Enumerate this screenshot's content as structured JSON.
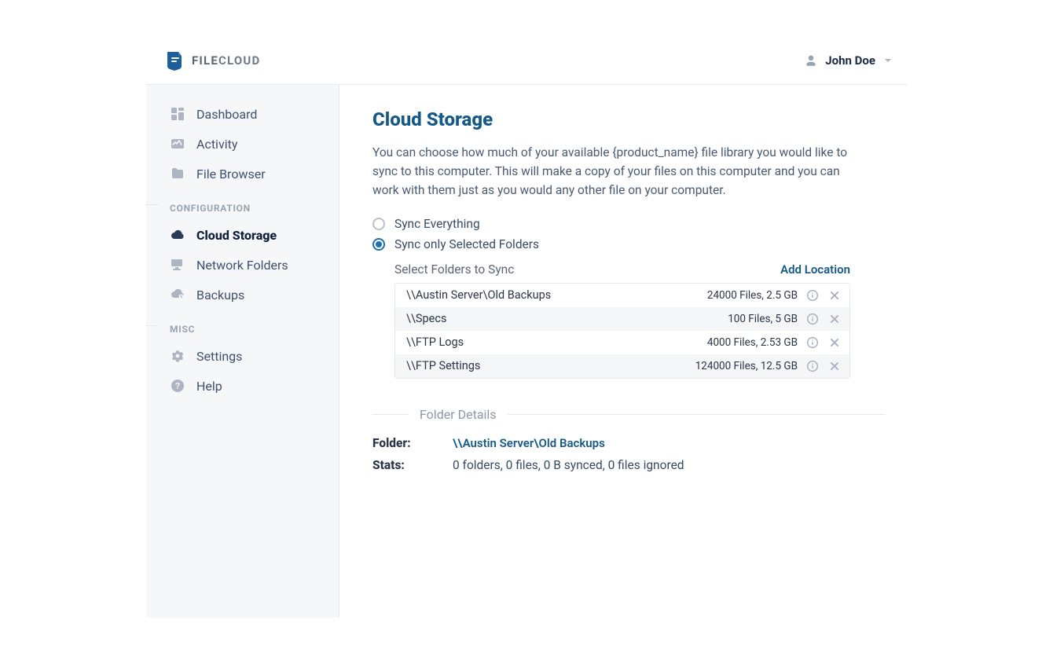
{
  "brand": {
    "name_strong": "FILE",
    "name_light": "CLOUD"
  },
  "user": {
    "name": "John Doe"
  },
  "sidebar": {
    "groups": [
      {
        "title": null,
        "items": [
          {
            "label": "Dashboard",
            "active": false
          },
          {
            "label": "Activity",
            "active": false
          },
          {
            "label": "File Browser",
            "active": false
          }
        ]
      },
      {
        "title": "CONFIGURATION",
        "items": [
          {
            "label": "Cloud Storage",
            "active": true
          },
          {
            "label": "Network Folders",
            "active": false
          },
          {
            "label": "Backups",
            "active": false
          }
        ]
      },
      {
        "title": "MISC",
        "items": [
          {
            "label": "Settings",
            "active": false
          },
          {
            "label": "Help",
            "active": false
          }
        ]
      }
    ]
  },
  "main": {
    "title": "Cloud Storage",
    "lead": "You can choose how much of your available {product_name} file library you would like to sync to this computer. This will make a copy of your files on this computer and you can work with them just as you would any other file on your computer.",
    "radios": {
      "opt1": "Sync Everything",
      "opt2": "Sync only Selected Folders",
      "selected": "opt2"
    },
    "panel": {
      "title": "Select Folders to Sync",
      "add_link": "Add Location",
      "rows": [
        {
          "path": "\\\\Austin Server\\Old Backups",
          "meta": "24000 Files, 2.5 GB"
        },
        {
          "path": "\\\\Specs",
          "meta": "100 Files, 5 GB"
        },
        {
          "path": "\\\\FTP Logs",
          "meta": "4000 Files, 2.53 GB"
        },
        {
          "path": "\\\\FTP Settings",
          "meta": "124000 Files, 12.5 GB"
        }
      ]
    },
    "details": {
      "heading": "Folder Details",
      "folder_label": "Folder:",
      "folder_value": "\\\\Austin Server\\Old Backups",
      "stats_label": "Stats:",
      "stats_value": "0 folders, 0 files, 0 B synced, 0 files ignored"
    }
  }
}
